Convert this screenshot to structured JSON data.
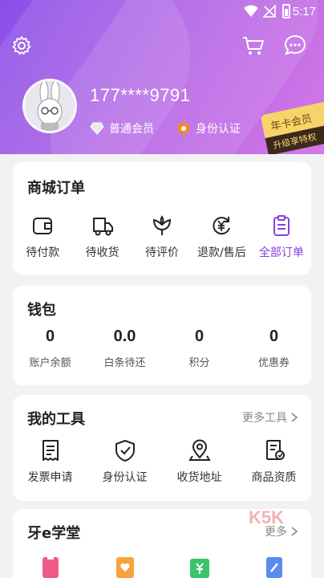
{
  "status": {
    "time": "5:17"
  },
  "profile": {
    "phone": "177****9791",
    "member_label": "普通会员",
    "verify_label": "身份认证",
    "annual_card_title": "年卡会员",
    "annual_card_sub": "升级享特权"
  },
  "orders": {
    "title": "商城订单",
    "items": [
      {
        "label": "待付款",
        "icon": "wallet-icon"
      },
      {
        "label": "待收货",
        "icon": "truck-icon"
      },
      {
        "label": "待评价",
        "icon": "flower-icon"
      },
      {
        "label": "退款/售后",
        "icon": "refund-icon"
      },
      {
        "label": "全部订单",
        "icon": "clipboard-icon"
      }
    ]
  },
  "wallet": {
    "title": "钱包",
    "items": [
      {
        "value": "0",
        "label": "账户余额"
      },
      {
        "value": "0.0",
        "label": "白条待还"
      },
      {
        "value": "0",
        "label": "积分"
      },
      {
        "value": "0",
        "label": "优惠券"
      }
    ]
  },
  "tools": {
    "title": "我的工具",
    "more": "更多工具",
    "items": [
      {
        "label": "发票申请",
        "icon": "invoice-icon"
      },
      {
        "label": "身份认证",
        "icon": "shield-check-icon"
      },
      {
        "label": "收货地址",
        "icon": "location-pin-icon"
      },
      {
        "label": "商品资质",
        "icon": "certificate-icon"
      }
    ]
  },
  "academy": {
    "title": "牙e学堂",
    "more": "更多"
  },
  "colors": {
    "accent": "#8a3fe0",
    "header_start": "#8a4fe8",
    "header_end": "#d478e6"
  }
}
